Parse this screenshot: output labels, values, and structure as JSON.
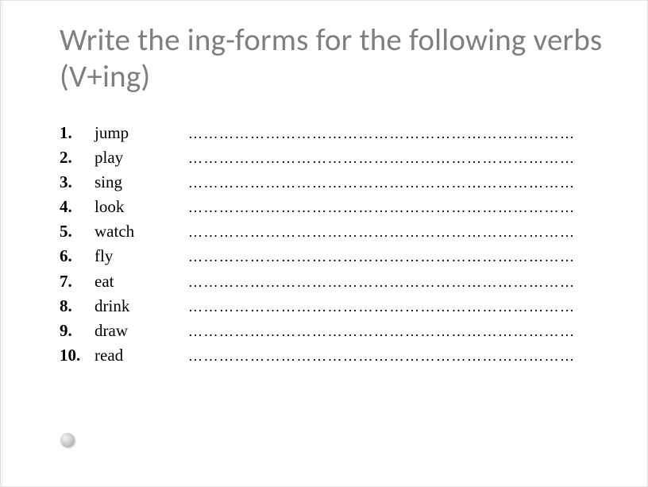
{
  "title": "Write the ing-forms for the following verbs (V+ing)",
  "items": [
    {
      "n": "1.",
      "verb": "jump"
    },
    {
      "n": "2.",
      "verb": "play"
    },
    {
      "n": "3.",
      "verb": "sing"
    },
    {
      "n": "4.",
      "verb": "look"
    },
    {
      "n": "5.",
      "verb": "watch"
    },
    {
      "n": "6.",
      "verb": "fly"
    },
    {
      "n": "7.",
      "verb": "eat"
    },
    {
      "n": "8.",
      "verb": "drink"
    },
    {
      "n": "9.",
      "verb": "draw"
    },
    {
      "n": "10.",
      "verb": "read"
    }
  ],
  "blank_line": "…………………………………………………………………"
}
